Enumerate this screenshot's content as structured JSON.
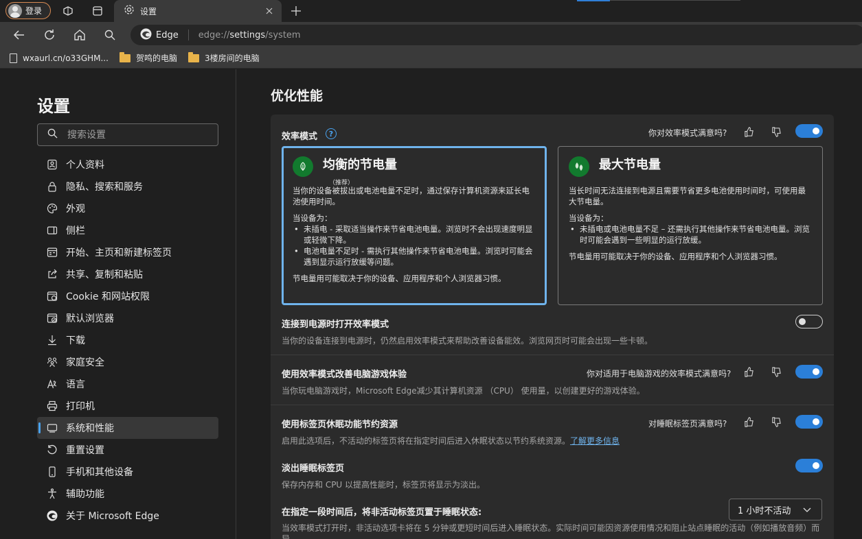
{
  "browser": {
    "profile_label": "登录",
    "active_tab_title": "设置",
    "omnibox_chip": "Edge",
    "url_prefix": "edge://",
    "url_host": "settings",
    "url_path": "/system",
    "bookmarks": [
      {
        "label": "wxaurl.cn/o33GHM...",
        "icon": "page-icon"
      },
      {
        "label": "贺鸣的电脑",
        "icon": "folder-icon"
      },
      {
        "label": "3楼房间的电脑",
        "icon": "folder-icon"
      }
    ]
  },
  "sidebar": {
    "title": "设置",
    "search_placeholder": "搜索设置",
    "items": [
      {
        "label": "个人资料",
        "icon": "profile-icon"
      },
      {
        "label": "隐私、搜索和服务",
        "icon": "lock-icon"
      },
      {
        "label": "外观",
        "icon": "palette-icon"
      },
      {
        "label": "侧栏",
        "icon": "sidebar-icon"
      },
      {
        "label": "开始、主页和新建标签页",
        "icon": "home-tabs-icon"
      },
      {
        "label": "共享、复制和粘贴",
        "icon": "share-icon"
      },
      {
        "label": "Cookie 和网站权限",
        "icon": "cookie-icon"
      },
      {
        "label": "默认浏览器",
        "icon": "default-browser-icon"
      },
      {
        "label": "下载",
        "icon": "download-icon"
      },
      {
        "label": "家庭安全",
        "icon": "family-icon"
      },
      {
        "label": "语言",
        "icon": "language-icon"
      },
      {
        "label": "打印机",
        "icon": "printer-icon"
      },
      {
        "label": "系统和性能",
        "icon": "system-icon",
        "active": true
      },
      {
        "label": "重置设置",
        "icon": "reset-icon"
      },
      {
        "label": "手机和其他设备",
        "icon": "phone-icon"
      },
      {
        "label": "辅助功能",
        "icon": "accessibility-icon"
      },
      {
        "label": "关于 Microsoft Edge",
        "icon": "edge-icon"
      }
    ]
  },
  "main": {
    "section_title": "优化性能",
    "efficiency": {
      "title": "效率模式",
      "help_glyph": "?",
      "feedback": "你对效率模式满意吗?",
      "enabled": true
    },
    "modes": {
      "balanced": {
        "name": "均衡的节电量",
        "tag": "（推荐）",
        "intro": "当你的设备被拔出或电池电量不足时，通过保存计算机资源来延长电池使用时间。",
        "when_label": "当设备为：",
        "bullets": [
          "未插电 - 采取适当操作来节省电池电量。浏览时不会出现速度明显或轻微下降。",
          "电池电量不足时 - 需执行其他操作来节省电池电量。浏览时可能会遇到显示运行放缓等问题。"
        ],
        "footer": "节电量用可能取决于你的设备、应用程序和个人浏览器习惯。"
      },
      "maximum": {
        "name": "最大节电量",
        "intro": "当长时间无法连接到电源且需要节省更多电池使用时间时，可使用最大节电量。",
        "when_label": "当设备为：",
        "bullets": [
          "未插电或电池电量不足 – 还需执行其他操作来节省电池电量。浏览时可能会遇到一些明显的运行放缓。"
        ],
        "footer": "节电量用可能取决于你的设备、应用程序和个人浏览器习惯。"
      }
    },
    "power_connected": {
      "title": "连接到电源时打开效率模式",
      "desc": "当你的设备连接到电源时，仍然启用效率模式来帮助改善设备能效。浏览网页时可能会出现一些卡顿。",
      "enabled": false
    },
    "gaming": {
      "title": "使用效率模式改善电脑游戏体验",
      "feedback": "你对适用于电脑游戏的效率模式满意吗?",
      "desc": "当你玩电脑游戏时，Microsoft Edge减少其计算机资源 （CPU） 使用量，以创建更好的游戏体验。",
      "enabled": true
    },
    "sleeping_tabs": {
      "title": "使用标签页休眠功能节约资源",
      "feedback": "对睡眠标签页满意吗?",
      "desc": "启用此选项后，不活动的标签页将在指定时间后进入休眠状态以节约系统资源。",
      "link": "了解更多信息",
      "enabled": true
    },
    "fade_tabs": {
      "title": "淡出睡眠标签页",
      "desc": "保存内存和 CPU 以提高性能时，标签页将显示为淡出。",
      "enabled": true
    },
    "sleep_after": {
      "title": "在指定一段时间后，将非活动标签页置于睡眠状态:",
      "selected": "1 小时不活动",
      "desc": "当效率模式打开时，非活动选项卡将在 5 分钟或更短时间后进入睡眠状态。实际时间可能因资源使用情况和阻止站点睡眠的活动（例如播放音频）而异。"
    }
  }
}
